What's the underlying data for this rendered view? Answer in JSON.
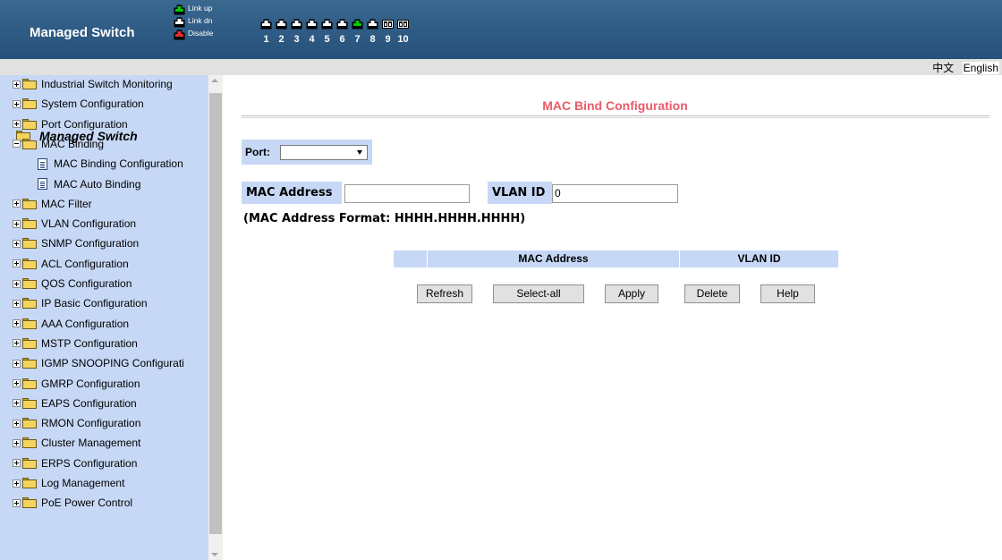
{
  "header": {
    "title": "Managed Switch",
    "legend": [
      {
        "label": "Link up",
        "color": "#00cc00"
      },
      {
        "label": "Link dn",
        "color": "#ffffff"
      },
      {
        "label": "Disable",
        "color": "#e53030"
      }
    ],
    "ports": [
      {
        "num": "1",
        "state": "dn"
      },
      {
        "num": "2",
        "state": "dn"
      },
      {
        "num": "3",
        "state": "dn"
      },
      {
        "num": "4",
        "state": "dn"
      },
      {
        "num": "5",
        "state": "dn"
      },
      {
        "num": "6",
        "state": "dn"
      },
      {
        "num": "7",
        "state": "up"
      },
      {
        "num": "8",
        "state": "dn"
      },
      {
        "num": "9",
        "state": "fiber"
      },
      {
        "num": "10",
        "state": "fiber"
      }
    ]
  },
  "language": {
    "chinese": "中文",
    "english": "English"
  },
  "sidebar": {
    "root_label": "Managed Switch",
    "items": [
      {
        "label": "Industrial Switch Monitoring",
        "expanded": false
      },
      {
        "label": "System Configuration",
        "expanded": false
      },
      {
        "label": "Port Configuration",
        "expanded": false
      },
      {
        "label": "MAC Binding",
        "expanded": true
      },
      {
        "label": "MAC Filter",
        "expanded": false
      },
      {
        "label": "VLAN Configuration",
        "expanded": false
      },
      {
        "label": "SNMP Configuration",
        "expanded": false
      },
      {
        "label": "ACL Configuration",
        "expanded": false
      },
      {
        "label": "QOS Configuration",
        "expanded": false
      },
      {
        "label": "IP Basic Configuration",
        "expanded": false
      },
      {
        "label": "AAA Configuration",
        "expanded": false
      },
      {
        "label": "MSTP Configuration",
        "expanded": false
      },
      {
        "label": "IGMP SNOOPING Configurati",
        "expanded": false
      },
      {
        "label": "GMRP Configuration",
        "expanded": false
      },
      {
        "label": "EAPS Configuration",
        "expanded": false
      },
      {
        "label": "RMON Configuration",
        "expanded": false
      },
      {
        "label": "Cluster Management",
        "expanded": false
      },
      {
        "label": "ERPS Configuration",
        "expanded": false
      },
      {
        "label": "Log Management",
        "expanded": false
      },
      {
        "label": "PoE Power Control",
        "expanded": false
      }
    ],
    "mac_binding_children": [
      {
        "label": "MAC Binding Configuration"
      },
      {
        "label": "MAC Auto Binding"
      }
    ]
  },
  "main": {
    "title": "MAC Bind Configuration",
    "port_label": "Port:",
    "port_value": "",
    "mac_label": "MAC Address",
    "mac_value": "",
    "vlan_label": "VLAN ID",
    "vlan_value": "0",
    "format_hint": "(MAC Address Format: HHHH.HHHH.HHHH)",
    "table_headers": [
      "",
      "MAC Address",
      "VLAN ID"
    ],
    "buttons": {
      "refresh": "Refresh",
      "select_all": "Select-all",
      "apply": "Apply",
      "delete": "Delete",
      "help": "Help"
    }
  }
}
